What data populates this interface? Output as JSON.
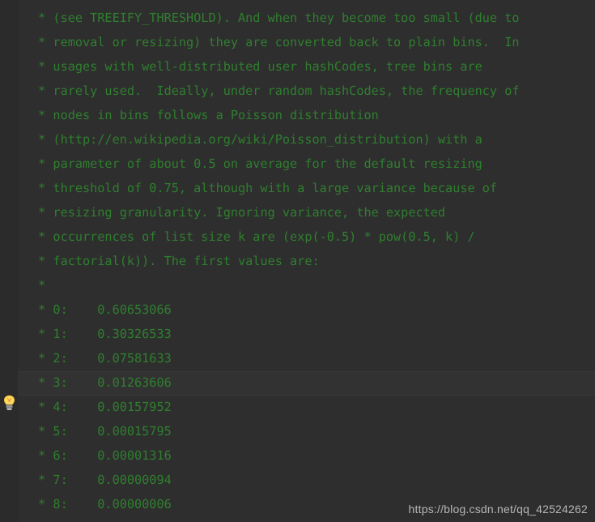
{
  "editor": {
    "app": "code-editor",
    "language": "java",
    "theme": "darcula",
    "background_color": "#2e2e2e",
    "gutter_color": "#2b2b2b",
    "comment_color": "#2f7f2f",
    "caret_line_color": "#323232",
    "caret_line_index": 16,
    "font_size_px": 15,
    "line_height_px": 30,
    "lines": [
      {
        "text": "",
        "partial": true
      },
      {
        "text": " * (see TREEIFY_THRESHOLD). And when they become too small (due to"
      },
      {
        "text": " * removal or resizing) they are converted back to plain bins.  In"
      },
      {
        "text": " * usages with well-distributed user hashCodes, tree bins are"
      },
      {
        "text": " * rarely used.  Ideally, under random hashCodes, the frequency of"
      },
      {
        "text": " * nodes in bins follows a Poisson distribution"
      },
      {
        "text": " * (http://en.wikipedia.org/wiki/Poisson_distribution) with a"
      },
      {
        "text": " * parameter of about 0.5 on average for the default resizing"
      },
      {
        "text": " * threshold of 0.75, although with a large variance because of"
      },
      {
        "text": " * resizing granularity. Ignoring variance, the expected"
      },
      {
        "text": " * occurrences of list size k are (exp(-0.5) * pow(0.5, k) /"
      },
      {
        "text": " * factorial(k)). The first values are:"
      },
      {
        "text": " *"
      },
      {
        "text": " * 0:    0.60653066"
      },
      {
        "text": " * 1:    0.30326533"
      },
      {
        "text": " * 2:    0.07581633"
      },
      {
        "text": " * 3:    0.01263606"
      },
      {
        "text": " * 4:    0.00157952"
      },
      {
        "text": " * 5:    0.00015795"
      },
      {
        "text": " * 6:    0.00001316"
      },
      {
        "text": " * 7:    0.00000094"
      },
      {
        "text": " * 8:    0.00000006"
      }
    ]
  },
  "gutter": {
    "intention_bulb": {
      "icon": "lightbulb-icon",
      "tooltip": "Show intention actions",
      "color": "#f5b335"
    }
  },
  "watermark": {
    "text": "https://blog.csdn.net/qq_42524262",
    "color": "#b6b6b6"
  }
}
